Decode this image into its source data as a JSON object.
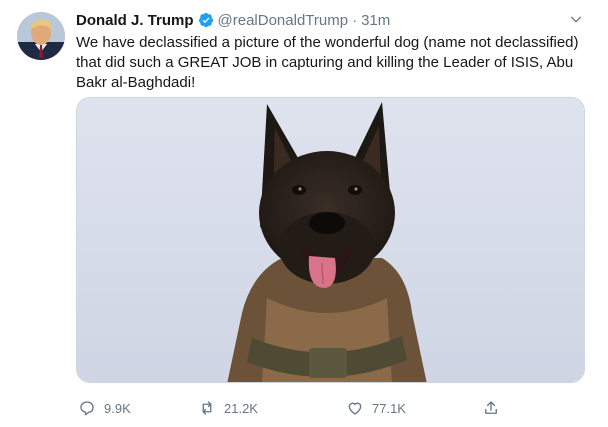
{
  "tweet": {
    "display_name": "Donald J. Trump",
    "handle": "@realDonaldTrump",
    "separator": "·",
    "time": "31m",
    "text": "We have declassified a picture of the wonderful dog (name not declassified) that did such a GREAT JOB in capturing and killing the Leader of ISIS, Abu Bakr al-Baghdadi!",
    "verified": true
  },
  "actions": {
    "replies": "9.9K",
    "retweets": "21.2K",
    "likes": "77.1K"
  },
  "icons": {
    "verified": "verified-badge-icon",
    "caret": "chevron-down-icon",
    "reply": "reply-icon",
    "retweet": "retweet-icon",
    "like": "heart-icon",
    "share": "share-icon"
  },
  "colors": {
    "accent": "#1da1f2",
    "text": "#14171a",
    "secondary": "#657786",
    "border": "#ccd6dd"
  }
}
